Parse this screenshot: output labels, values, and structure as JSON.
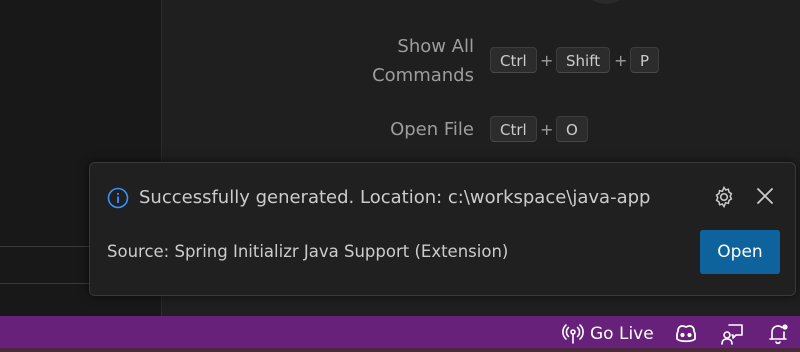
{
  "shortcuts": [
    {
      "label_line1": "Show All",
      "label_line2": "Commands",
      "keys": [
        "Ctrl",
        "Shift",
        "P"
      ]
    },
    {
      "label_line1": "Open File",
      "keys": [
        "Ctrl",
        "O"
      ]
    }
  ],
  "shortcut_separator": "+",
  "notification": {
    "icon": "info-icon",
    "message": "Successfully generated. Location: c:\\workspace\\java-app",
    "source": "Source: Spring Initializr Java Support (Extension)",
    "open_label": "Open",
    "settings_icon": "gear-icon",
    "close_icon": "close-icon"
  },
  "statusbar": {
    "background": "#68217a",
    "go_live_label": "Go Live",
    "icons": [
      "broadcast-icon",
      "copilot-icon",
      "feedback-icon",
      "notifications-bell-icon"
    ]
  },
  "colors": {
    "accent_button": "#0e639c",
    "info_blue": "#3794ff"
  }
}
